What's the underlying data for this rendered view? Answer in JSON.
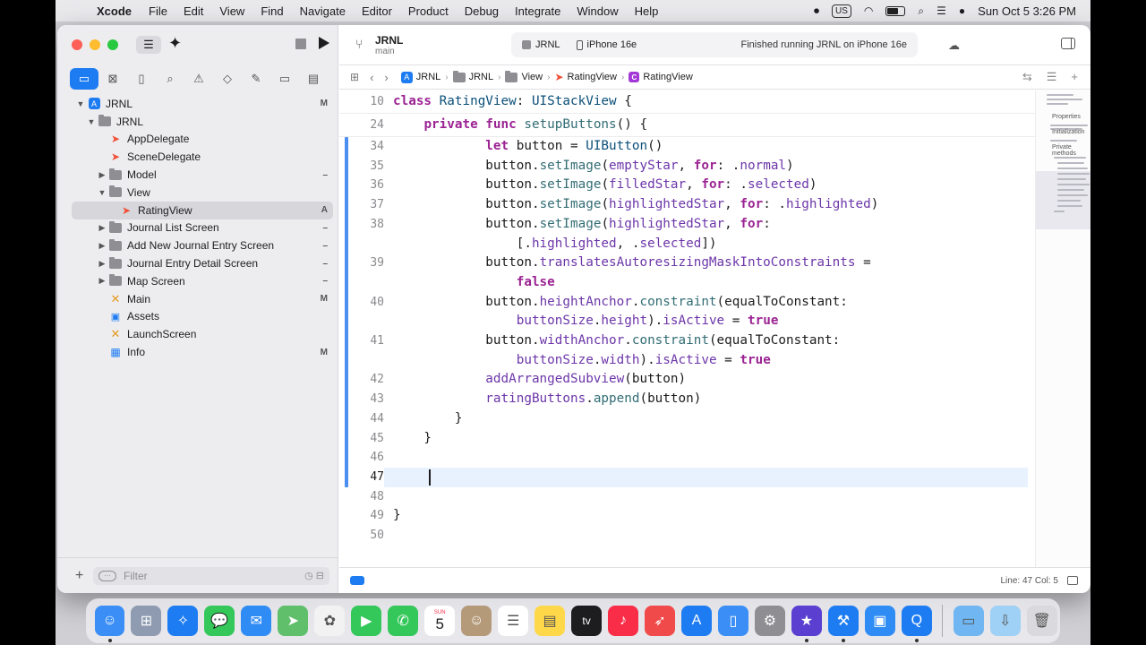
{
  "menubar": {
    "apple_glyph": "",
    "app_name": "Xcode",
    "menus": [
      "File",
      "Edit",
      "View",
      "Find",
      "Navigate",
      "Editor",
      "Product",
      "Debug",
      "Integrate",
      "Window",
      "Help"
    ],
    "input_source": "US",
    "datetime": "Sun Oct 5  3:26 PM"
  },
  "toolbar": {
    "project_name": "JRNL",
    "branch": "main",
    "activity": {
      "scheme": "JRNL",
      "device": "iPhone 16e",
      "status": "Finished running JRNL on iPhone 16e"
    }
  },
  "jumpbar": {
    "crumbs": [
      "JRNL",
      "JRNL",
      "View",
      "RatingView",
      "RatingView"
    ]
  },
  "navigator": {
    "tabs": [
      "folder-icon",
      "source-control-icon",
      "bookmark-icon",
      "search-icon",
      "issue-icon",
      "test-icon",
      "debug-icon",
      "breakpoint-icon",
      "report-icon"
    ],
    "items": [
      {
        "label": "JRNL",
        "badge": "M"
      },
      {
        "label": "JRNL",
        "badge": ""
      },
      {
        "label": "AppDelegate",
        "badge": ""
      },
      {
        "label": "SceneDelegate",
        "badge": ""
      },
      {
        "label": "Model",
        "badge": "–"
      },
      {
        "label": "View",
        "badge": ""
      },
      {
        "label": "RatingView",
        "badge": "A"
      },
      {
        "label": "Journal List Screen",
        "badge": "–"
      },
      {
        "label": "Add New Journal Entry Screen",
        "badge": "–"
      },
      {
        "label": "Journal Entry Detail Screen",
        "badge": "–"
      },
      {
        "label": "Map Screen",
        "badge": "–"
      },
      {
        "label": "Main",
        "badge": "M"
      },
      {
        "label": "Assets",
        "badge": ""
      },
      {
        "label": "LaunchScreen",
        "badge": ""
      },
      {
        "label": "Info",
        "badge": "M"
      }
    ],
    "filter_placeholder": "Filter"
  },
  "editor": {
    "sticky": [
      {
        "line": "10",
        "code": "class RatingView: UIStackView {"
      },
      {
        "line": "24",
        "code": "    private func setupButtons() {"
      }
    ],
    "lines": [
      {
        "n": "34",
        "code": "            let button = UIButton()"
      },
      {
        "n": "35",
        "code": "            button.setImage(emptyStar, for: .normal)"
      },
      {
        "n": "36",
        "code": "            button.setImage(filledStar, for: .selected)"
      },
      {
        "n": "37",
        "code": "            button.setImage(highlightedStar, for: .highlighted)"
      },
      {
        "n": "38",
        "code": "            button.setImage(highlightedStar, for:"
      },
      {
        "n": "",
        "code": "                [.highlighted, .selected])"
      },
      {
        "n": "39",
        "code": "            button.translatesAutoresizingMaskIntoConstraints ="
      },
      {
        "n": "",
        "code": "                false"
      },
      {
        "n": "40",
        "code": "            button.heightAnchor.constraint(equalToConstant:"
      },
      {
        "n": "",
        "code": "                buttonSize.height).isActive = true"
      },
      {
        "n": "41",
        "code": "            button.widthAnchor.constraint(equalToConstant:"
      },
      {
        "n": "",
        "code": "                buttonSize.width).isActive = true"
      },
      {
        "n": "42",
        "code": "            addArrangedSubview(button)"
      },
      {
        "n": "43",
        "code": "            ratingButtons.append(button)"
      },
      {
        "n": "44",
        "code": "        }"
      },
      {
        "n": "45",
        "code": "    }"
      },
      {
        "n": "46",
        "code": ""
      },
      {
        "n": "47",
        "code": ""
      },
      {
        "n": "48",
        "code": ""
      },
      {
        "n": "49",
        "code": "}"
      },
      {
        "n": "50",
        "code": ""
      }
    ],
    "current_line": "47"
  },
  "minimap": {
    "labels": [
      "Properties",
      "Initialization",
      "Private methods"
    ]
  },
  "statusbar": {
    "cursor": "Line: 47  Col: 5"
  },
  "dock": {
    "apps": [
      "Finder",
      "Launchpad",
      "Safari",
      "Messages",
      "Mail",
      "Maps",
      "Photos",
      "FaceTime",
      "Phone",
      "Calendar",
      "Contacts",
      "Reminders",
      "Notes",
      "TV",
      "Music",
      "Rocket",
      "App Store",
      "Simulator",
      "System Settings",
      "iMovie",
      "Xcode",
      "Screen Sharing",
      "QuickTime"
    ],
    "calendar_day": "5",
    "calendar_month": "SUN",
    "tv_label": "tv"
  },
  "colors": {
    "accent": "#1e7cf2",
    "keyword": "#9b2393",
    "type": "#0b4f79",
    "function": "#326d74",
    "property": "#6c36a9",
    "current_line": "#e8f2fe",
    "change_bar": "#4c8ff0"
  }
}
